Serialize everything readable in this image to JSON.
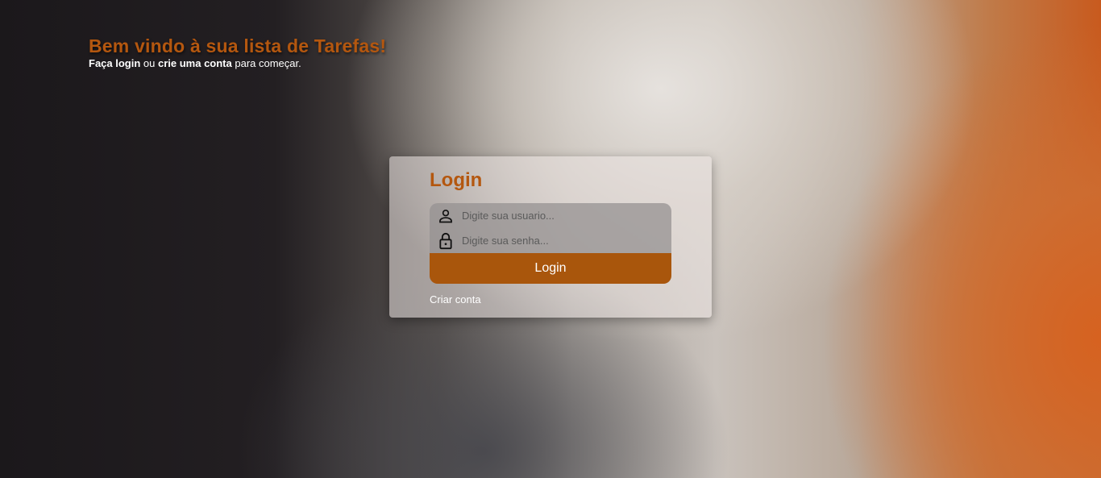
{
  "hero": {
    "title": "Bem vindo à sua lista de Tarefas!",
    "subtitle_part1": "Faça login",
    "subtitle_part2": " ou ",
    "subtitle_part3": "crie uma conta",
    "subtitle_part4": " para começar."
  },
  "login_card": {
    "title": "Login",
    "username_placeholder": "Digite sua usuario...",
    "username_value": "",
    "username_icon": "user-icon",
    "password_placeholder": "Digite sua senha...",
    "password_value": "",
    "password_icon": "lock-icon",
    "login_button_label": "Login",
    "create_account_link": "Criar conta"
  },
  "colors": {
    "accent": "#b4570f",
    "button": "#a9560c"
  }
}
